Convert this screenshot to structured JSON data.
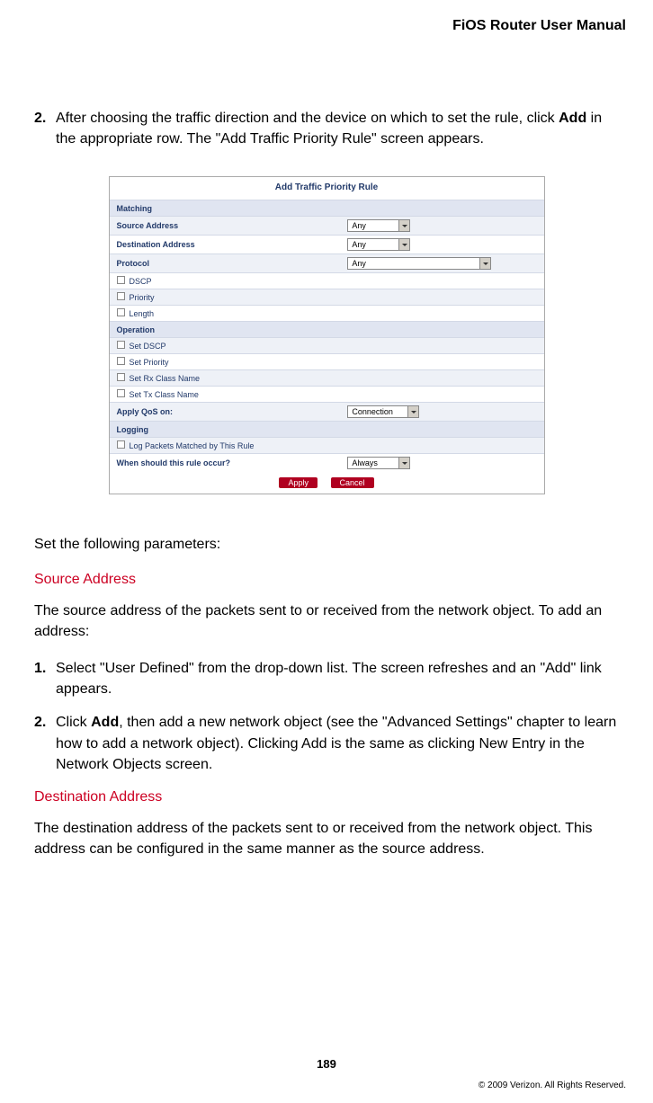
{
  "header": {
    "title": "FiOS Router User Manual"
  },
  "intro_step": {
    "num": "2.",
    "text_before": "After choosing the traffic direction and the device on which to set the rule, click ",
    "bold": "Add",
    "text_after": " in the appropriate row. The \"Add Traffic Priority Rule\" screen appears."
  },
  "screenshot": {
    "title": "Add Traffic Priority Rule",
    "rows": {
      "matching": "Matching",
      "source_addr": "Source Address",
      "dest_addr": "Destination Address",
      "protocol": "Protocol",
      "dscp": "DSCP",
      "priority": "Priority",
      "length": "Length",
      "operation": "Operation",
      "set_dscp": "Set DSCP",
      "set_priority": "Set Priority",
      "set_rx": "Set Rx Class Name",
      "set_tx": "Set Tx Class Name",
      "apply_qos": "Apply QoS on:",
      "logging": "Logging",
      "log_packets": "Log Packets Matched by This Rule",
      "when_occur": "When should this rule occur?"
    },
    "selects": {
      "any": "Any",
      "connection": "Connection",
      "always": "Always"
    },
    "buttons": {
      "apply": "Apply",
      "cancel": "Cancel"
    }
  },
  "set_params": "Set the following parameters:",
  "source": {
    "heading": "Source Address",
    "intro": "The source address of the packets sent to or received from the network object. To add an address:",
    "step1": {
      "num": "1.",
      "text": "Select \"User Defined\" from the drop-down list. The screen refreshes and an \"Add\" link appears."
    },
    "step2": {
      "num": "2.",
      "before": "Click ",
      "bold": "Add",
      "after": ", then add a new network object (see the \"Advanced Settings\" chapter to learn how to add a network object). Clicking Add is the same as clicking New Entry in the Network Objects screen."
    }
  },
  "dest": {
    "heading": "Destination Address",
    "text": "The destination address of the packets sent to or received from the network object. This address can be configured in the same manner as the source address."
  },
  "page_number": "189",
  "copyright": "© 2009 Verizon. All Rights Reserved."
}
